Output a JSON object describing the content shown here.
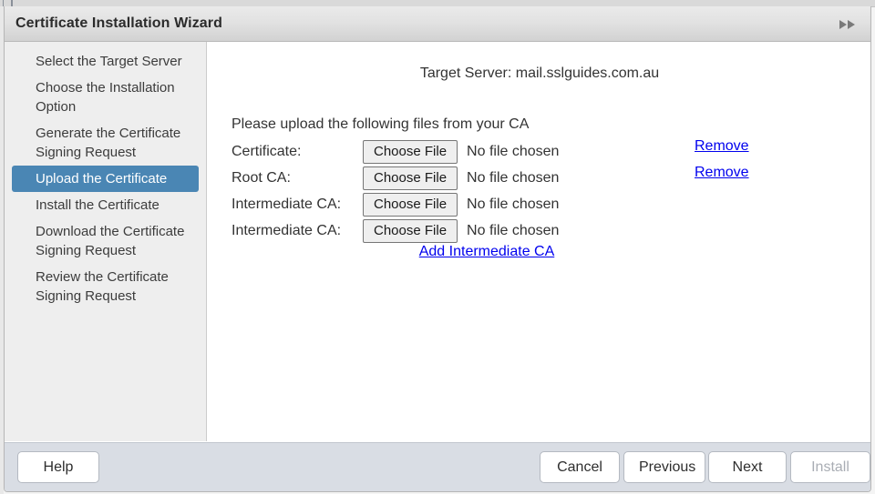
{
  "window": {
    "title": "Certificate Installation Wizard",
    "expand_icon": "double-chevron-right-icon"
  },
  "sidebar": {
    "items": [
      {
        "label": "Select the Target Server",
        "active": false
      },
      {
        "label": "Choose the Installation Option",
        "active": false
      },
      {
        "label": "Generate the Certificate Signing Request",
        "active": false
      },
      {
        "label": "Upload the Certificate",
        "active": true
      },
      {
        "label": "Install the Certificate",
        "active": false
      },
      {
        "label": "Download the Certificate Signing Request",
        "active": false
      },
      {
        "label": "Review the Certificate Signing Request",
        "active": false
      }
    ],
    "active_color": "#4a86b4"
  },
  "main": {
    "target_server_label": "Target Server:",
    "target_server_value": "mail.sslguides.com.au",
    "target_server_line": "Target Server:  mail.sslguides.com.au",
    "instruction": "Please upload the following files from your CA",
    "rows": [
      {
        "label": "Certificate:",
        "button_label": "Choose File",
        "file_status": "No file chosen",
        "remove_label": null
      },
      {
        "label": "Root CA:",
        "button_label": "Choose File",
        "file_status": "No file chosen",
        "remove_label": null
      },
      {
        "label": "Intermediate CA:",
        "button_label": "Choose File",
        "file_status": "No file chosen",
        "remove_label": "Remove"
      },
      {
        "label": "Intermediate CA:",
        "button_label": "Choose File",
        "file_status": "No file chosen",
        "remove_label": "Remove"
      }
    ],
    "add_intermediate_label": "Add Intermediate CA",
    "link_color": "#0000ee"
  },
  "footer": {
    "help_label": "Help",
    "cancel_label": "Cancel",
    "previous_label": "Previous",
    "next_label": "Next",
    "install_label": "Install",
    "install_enabled": false,
    "background_color": "#d9dde4"
  }
}
